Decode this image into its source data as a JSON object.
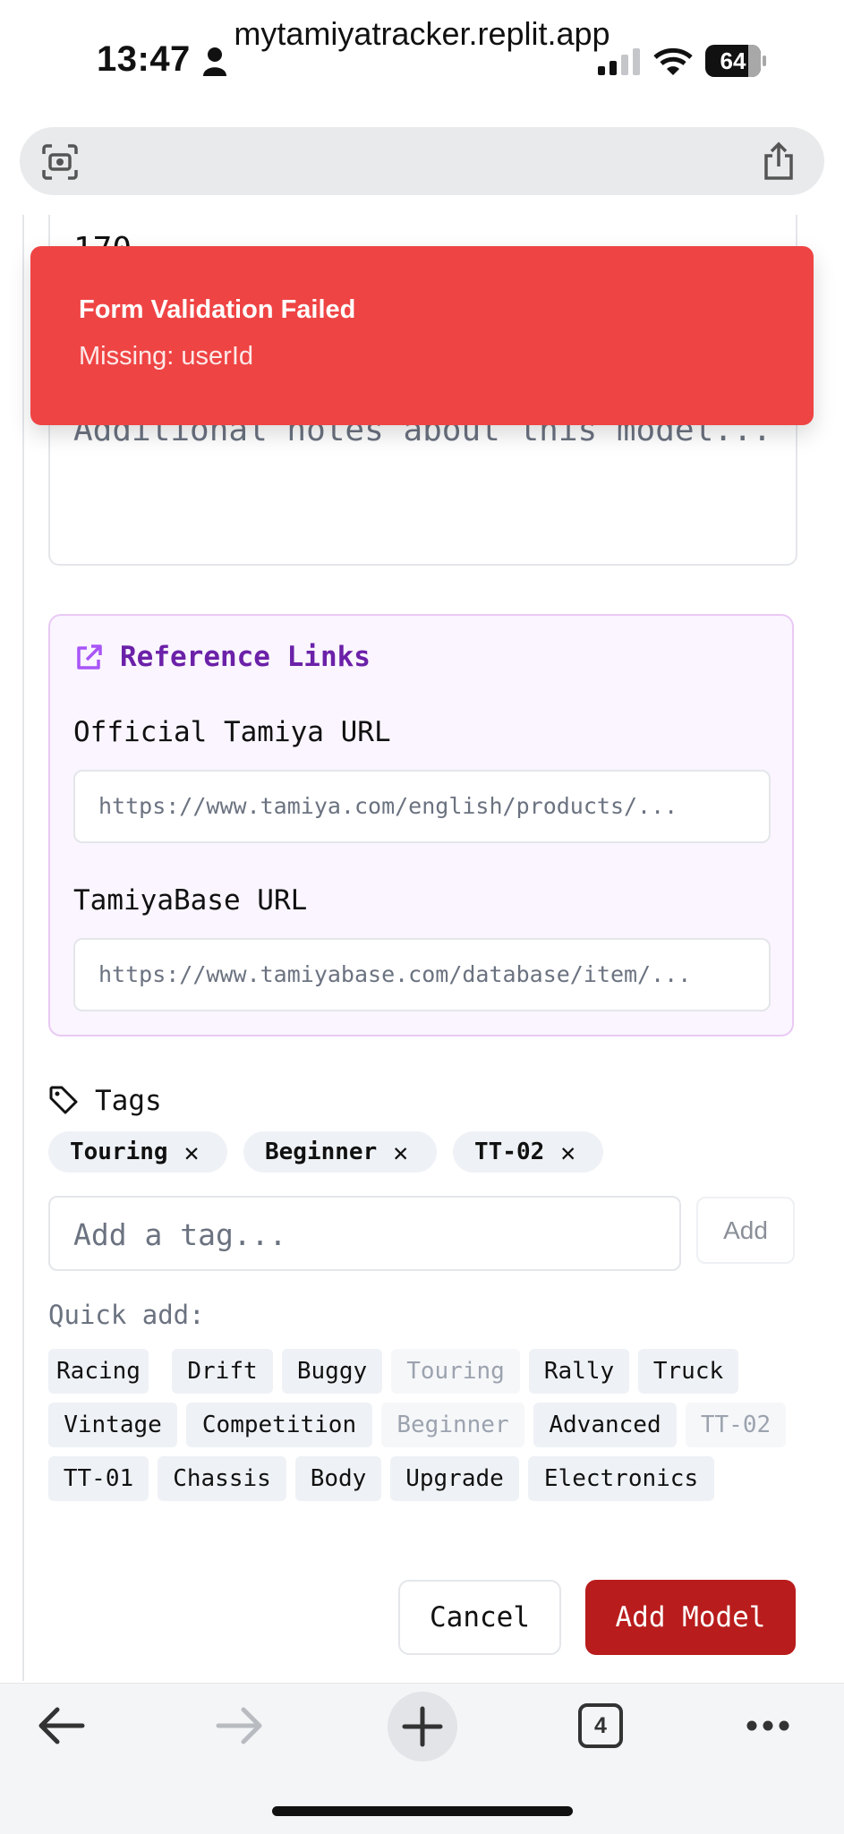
{
  "status_bar": {
    "time": "13:47",
    "battery": "64"
  },
  "browser": {
    "url": "mytamiyatracker.replit.app",
    "tab_count": "4"
  },
  "form": {
    "partial_value": "170",
    "notes_placeholder": "Additional notes about this model...",
    "reference_links": {
      "title": "Reference Links",
      "official_label": "Official Tamiya URL",
      "official_placeholder": "https://www.tamiya.com/english/products/...",
      "base_label": "TamiyaBase URL",
      "base_placeholder": "https://www.tamiyabase.com/database/item/..."
    },
    "tags": {
      "title": "Tags",
      "selected": [
        "Touring",
        "Beginner",
        "TT-02"
      ],
      "input_placeholder": "Add a tag...",
      "add_label": "Add",
      "quick_add_label": "Quick add:",
      "quick_add": [
        [
          "Racing",
          "Drift",
          "Buggy",
          "Touring",
          "Rally",
          "Truck"
        ],
        [
          "Vintage",
          "Competition",
          "Beginner",
          "Advanced",
          "TT-02"
        ],
        [
          "TT-01",
          "Chassis",
          "Body",
          "Upgrade",
          "Electronics"
        ]
      ]
    },
    "cancel_label": "Cancel",
    "submit_label": "Add Model"
  },
  "toast": {
    "title": "Form Validation Failed",
    "message": "Missing: userId"
  },
  "colors": {
    "toast_bg": "#ef4444",
    "primary": "#b91c1c",
    "ref_accent": "#6b21a8"
  }
}
